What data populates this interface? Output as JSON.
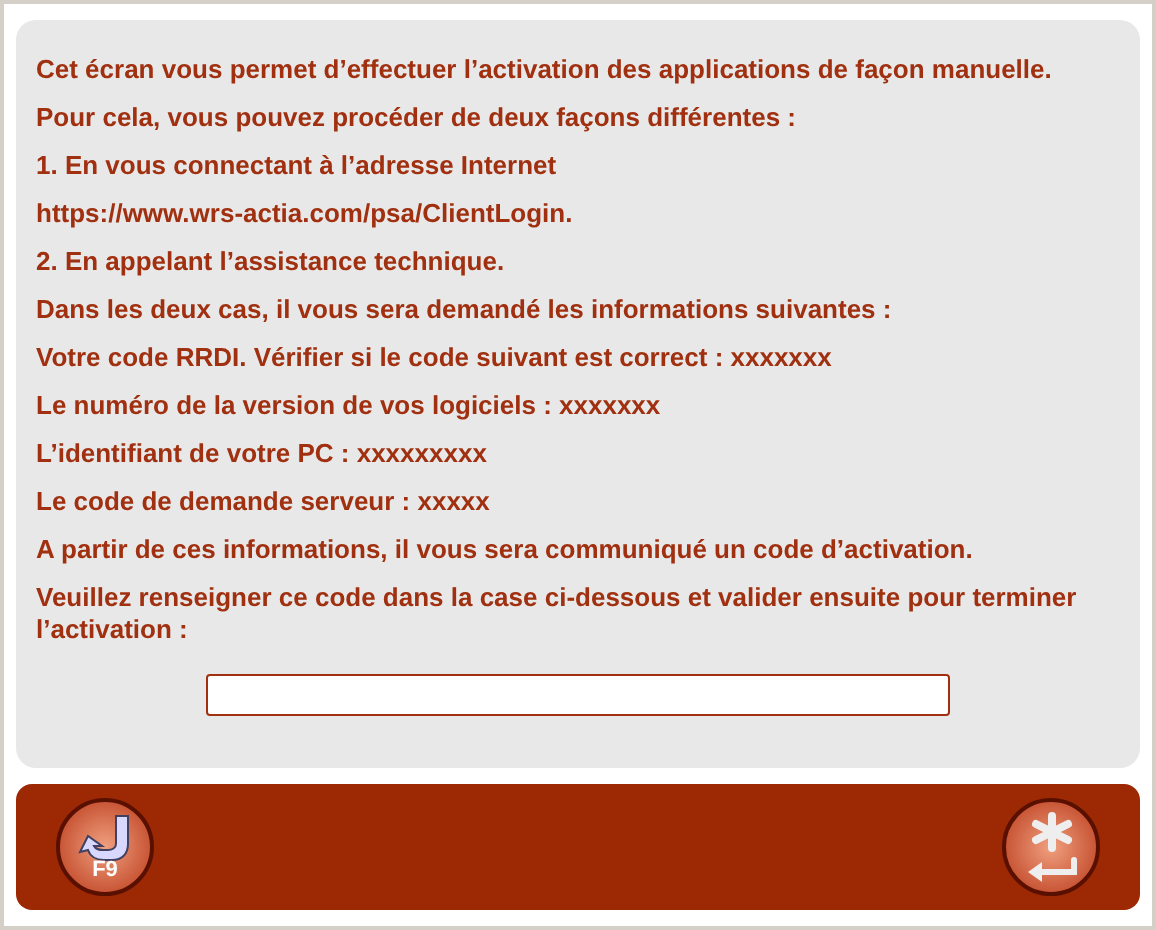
{
  "paragraphs": [
    "Cet écran vous permet d’effectuer l’activation des applications de façon manuelle.",
    "Pour cela, vous pouvez procéder de deux façons différentes :",
    "1. En vous connectant à l’adresse Internet",
    "https://www.wrs-actia.com/psa/ClientLogin.",
    "2. En appelant l’assistance technique.",
    "Dans les deux cas, il vous sera demandé les informations suivantes :",
    "Votre code RRDI. Vérifier si le code suivant est correct : xxxxxxx",
    "Le numéro de la version de vos logiciels : xxxxxxx",
    "L’identifiant de votre PC : xxxxxxxxx",
    "Le code de demande serveur : xxxxx",
    "A partir de ces informations, il vous sera communiqué un code d’activation.",
    "Veuillez renseigner ce code dans la case ci-dessous et valider ensuite pour terminer l’activation :"
  ],
  "footer": {
    "back_button": {
      "key": "F9"
    }
  }
}
